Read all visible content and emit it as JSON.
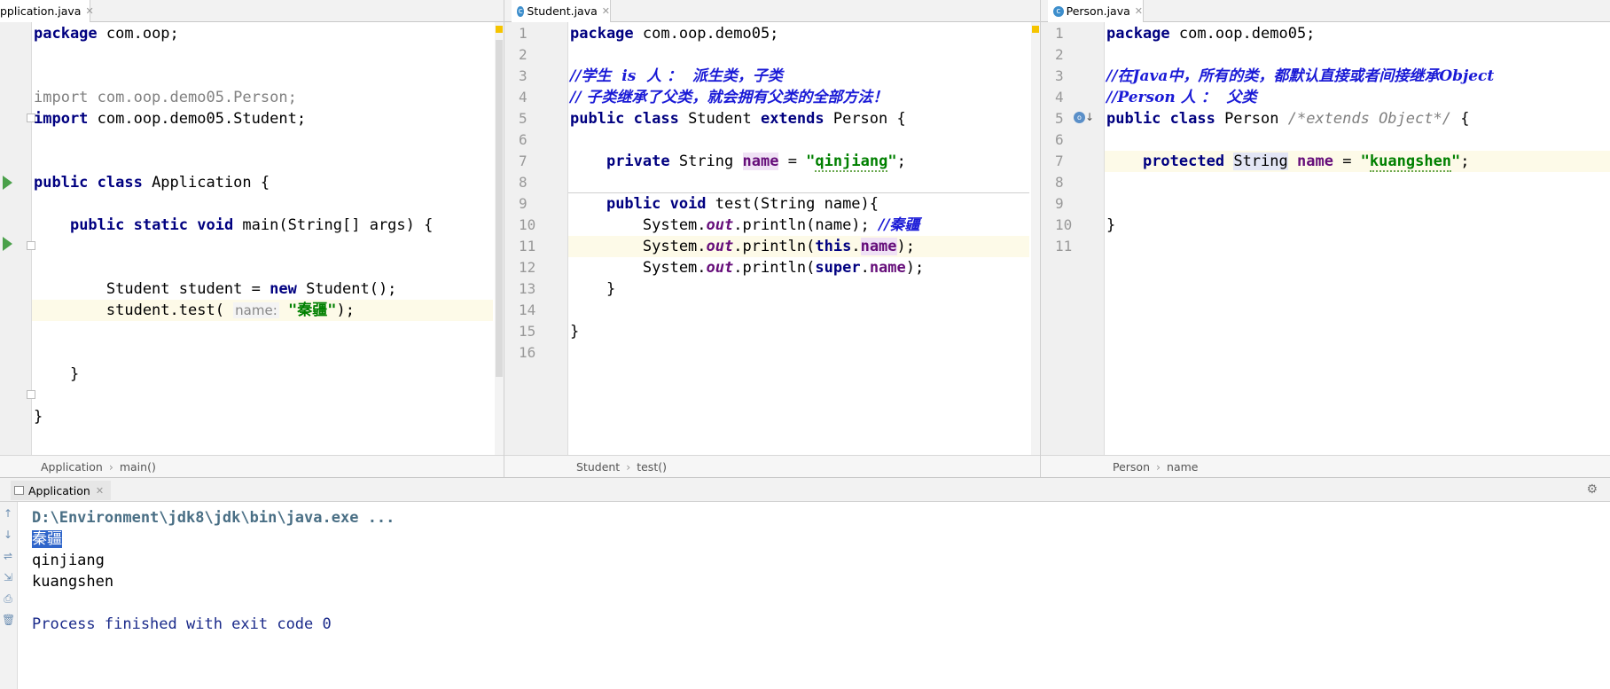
{
  "panes": {
    "app": {
      "tab_label": "pplication.java",
      "lines": [
        {
          "n": "",
          "html": "<span class=\"kw\">package</span> com.oop;"
        },
        {
          "n": "",
          "html": ""
        },
        {
          "n": "",
          "html": ""
        },
        {
          "n": "",
          "html": "<span class=\"gray\">import com.oop.demo05.Person;</span>"
        },
        {
          "n": "",
          "html": "<span class=\"kw\">import</span> com.oop.demo05.Student;"
        },
        {
          "n": "",
          "html": ""
        },
        {
          "n": "",
          "html": ""
        },
        {
          "n": "",
          "html": "<span class=\"kw\">public class</span> Application {"
        },
        {
          "n": "",
          "html": ""
        },
        {
          "n": "",
          "html": "    <span class=\"kw\">public static void</span> main(String[] args) {"
        },
        {
          "n": "",
          "html": ""
        },
        {
          "n": "",
          "html": ""
        },
        {
          "n": "",
          "html": "        Student student = <span class=\"kw\">new</span> Student();"
        },
        {
          "n": "",
          "html": "        student.test( <span class=\"hint\">name:</span> <span class=\"str\">\"秦疆\"</span>);",
          "hl": true
        },
        {
          "n": "",
          "html": ""
        },
        {
          "n": "",
          "html": ""
        },
        {
          "n": "",
          "html": "    }"
        },
        {
          "n": "",
          "html": ""
        },
        {
          "n": "",
          "html": "}"
        }
      ],
      "breadcrumb": [
        "Application",
        "main()"
      ]
    },
    "student": {
      "tab_label": "Student.java",
      "lines": [
        {
          "n": "1",
          "html": "<span class=\"kw\">package</span> com.oop.demo05;"
        },
        {
          "n": "2",
          "html": ""
        },
        {
          "n": "3",
          "html": "<span class=\"cm\">//学生  is  人 ：  派生类，子类</span>"
        },
        {
          "n": "4",
          "html": "<span class=\"cm\">// 子类继承了父类，就会拥有父类的全部方法！</span>"
        },
        {
          "n": "5",
          "html": "<span class=\"kw\">public class</span> Student <span class=\"kw\">extends</span> Person {"
        },
        {
          "n": "6",
          "html": ""
        },
        {
          "n": "7",
          "html": "    <span class=\"kw\">private</span> String <span class=\"fld wordhl\">name</span> = <span class=\"str\">\"<span class=\"chk\">qinjiang</span>\"</span>;"
        },
        {
          "n": "8",
          "html": ""
        },
        {
          "n": "9",
          "html": "    <span class=\"kw\">public void</span> test(String name){"
        },
        {
          "n": "10",
          "html": "        System.<span class=\"st\">out</span>.println(name); <span class=\"cm\">//秦疆</span>"
        },
        {
          "n": "11",
          "html": "        System.<span class=\"st\">out</span>.println(<span class=\"kw\">this</span>.<span class=\"fld wordhl\">name</span>);",
          "hl": true
        },
        {
          "n": "12",
          "html": "        System.<span class=\"st\">out</span>.println(<span class=\"kw\">super</span>.<span class=\"fld\">name</span>);"
        },
        {
          "n": "13",
          "html": "    }"
        },
        {
          "n": "14",
          "html": ""
        },
        {
          "n": "15",
          "html": "}"
        },
        {
          "n": "16",
          "html": ""
        }
      ],
      "breadcrumb": [
        "Student",
        "test()"
      ]
    },
    "person": {
      "tab_label": "Person.java",
      "lines": [
        {
          "n": "1",
          "html": "<span class=\"kw\">package</span> com.oop.demo05;"
        },
        {
          "n": "2",
          "html": ""
        },
        {
          "n": "3",
          "html": "<span class=\"cm\">//在Java中，所有的类，都默认直接或者间接继承Object</span>"
        },
        {
          "n": "4",
          "html": "<span class=\"cm\">//Person 人 ：  父类</span>"
        },
        {
          "n": "5",
          "html": "<span class=\"kw\">public class</span> Person <span class=\"cmg\">/*extends Object*/</span> {"
        },
        {
          "n": "6",
          "html": ""
        },
        {
          "n": "7",
          "html": "    <span class=\"kw\">protected</span> <span class=\"wordhl2\">String</span> <span class=\"fld\">name</span> = <span class=\"str\">\"<span class=\"chk\">kuangshen</span>\"</span>;",
          "hl": true
        },
        {
          "n": "8",
          "html": ""
        },
        {
          "n": "9",
          "html": ""
        },
        {
          "n": "10",
          "html": "}"
        },
        {
          "n": "11",
          "html": ""
        }
      ],
      "breadcrumb": [
        "Person",
        "name"
      ]
    }
  },
  "run": {
    "tab_label": "Application",
    "output": [
      {
        "text": "D:\\Environment\\jdk8\\jdk\\bin\\java.exe ...",
        "kind": "cmd"
      },
      {
        "text": "秦疆",
        "kind": "sel"
      },
      {
        "text": "qinjiang",
        "kind": "plain"
      },
      {
        "text": "kuangshen",
        "kind": "plain"
      },
      {
        "text": "",
        "kind": "plain"
      },
      {
        "text": "Process finished with exit code 0",
        "kind": "proc"
      }
    ]
  }
}
